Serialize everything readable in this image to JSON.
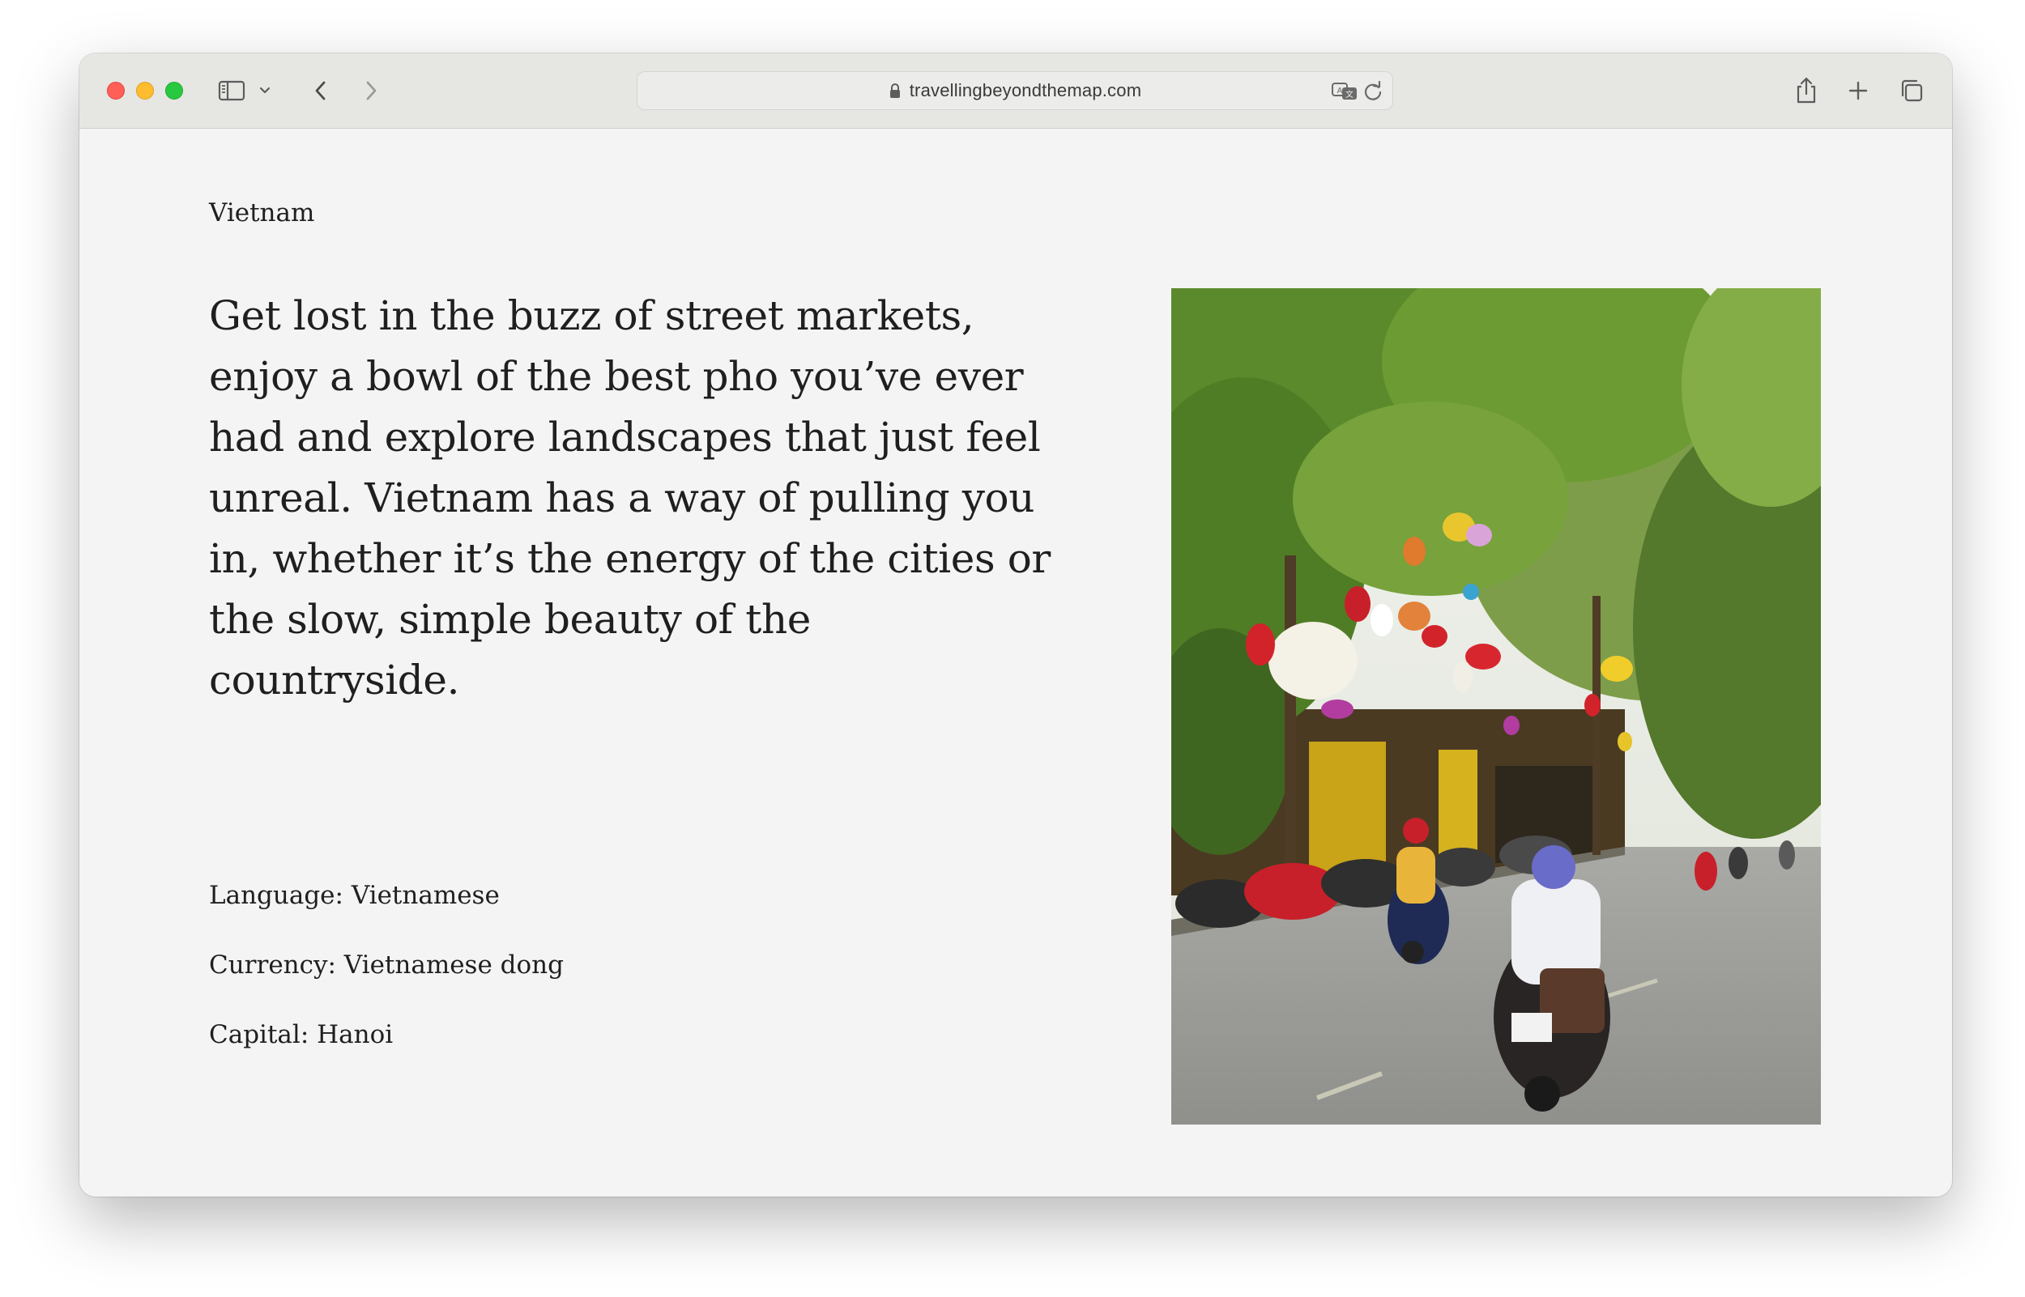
{
  "browser": {
    "url": "travellingbeyondthemap.com",
    "colors": {
      "close": "#ff5f57",
      "minimize": "#febc2e",
      "maximize": "#28c840",
      "toolbar": "#e6e6e3",
      "page_background": "#f4f4f4"
    },
    "icons": [
      "sidebar-icon",
      "chevron-down-icon",
      "back-arrow-icon",
      "forward-arrow-icon",
      "lock-icon",
      "translate-icon",
      "reload-icon",
      "share-icon",
      "plus-icon",
      "tabs-overview-icon"
    ]
  },
  "page": {
    "country": "Vietnam",
    "intro": "Get lost in the buzz of street markets, enjoy a bowl of the best pho you’ve ever had and explore landscapes that just feel unreal. Vietnam has a way of pulling you in, whether it’s the energy of the cities or the slow, simple beauty of the countryside.",
    "facts": [
      {
        "text": "Language: Vietnamese"
      },
      {
        "text": "Currency: Vietnamese dong"
      },
      {
        "text": "Capital: Hanoi"
      }
    ]
  }
}
